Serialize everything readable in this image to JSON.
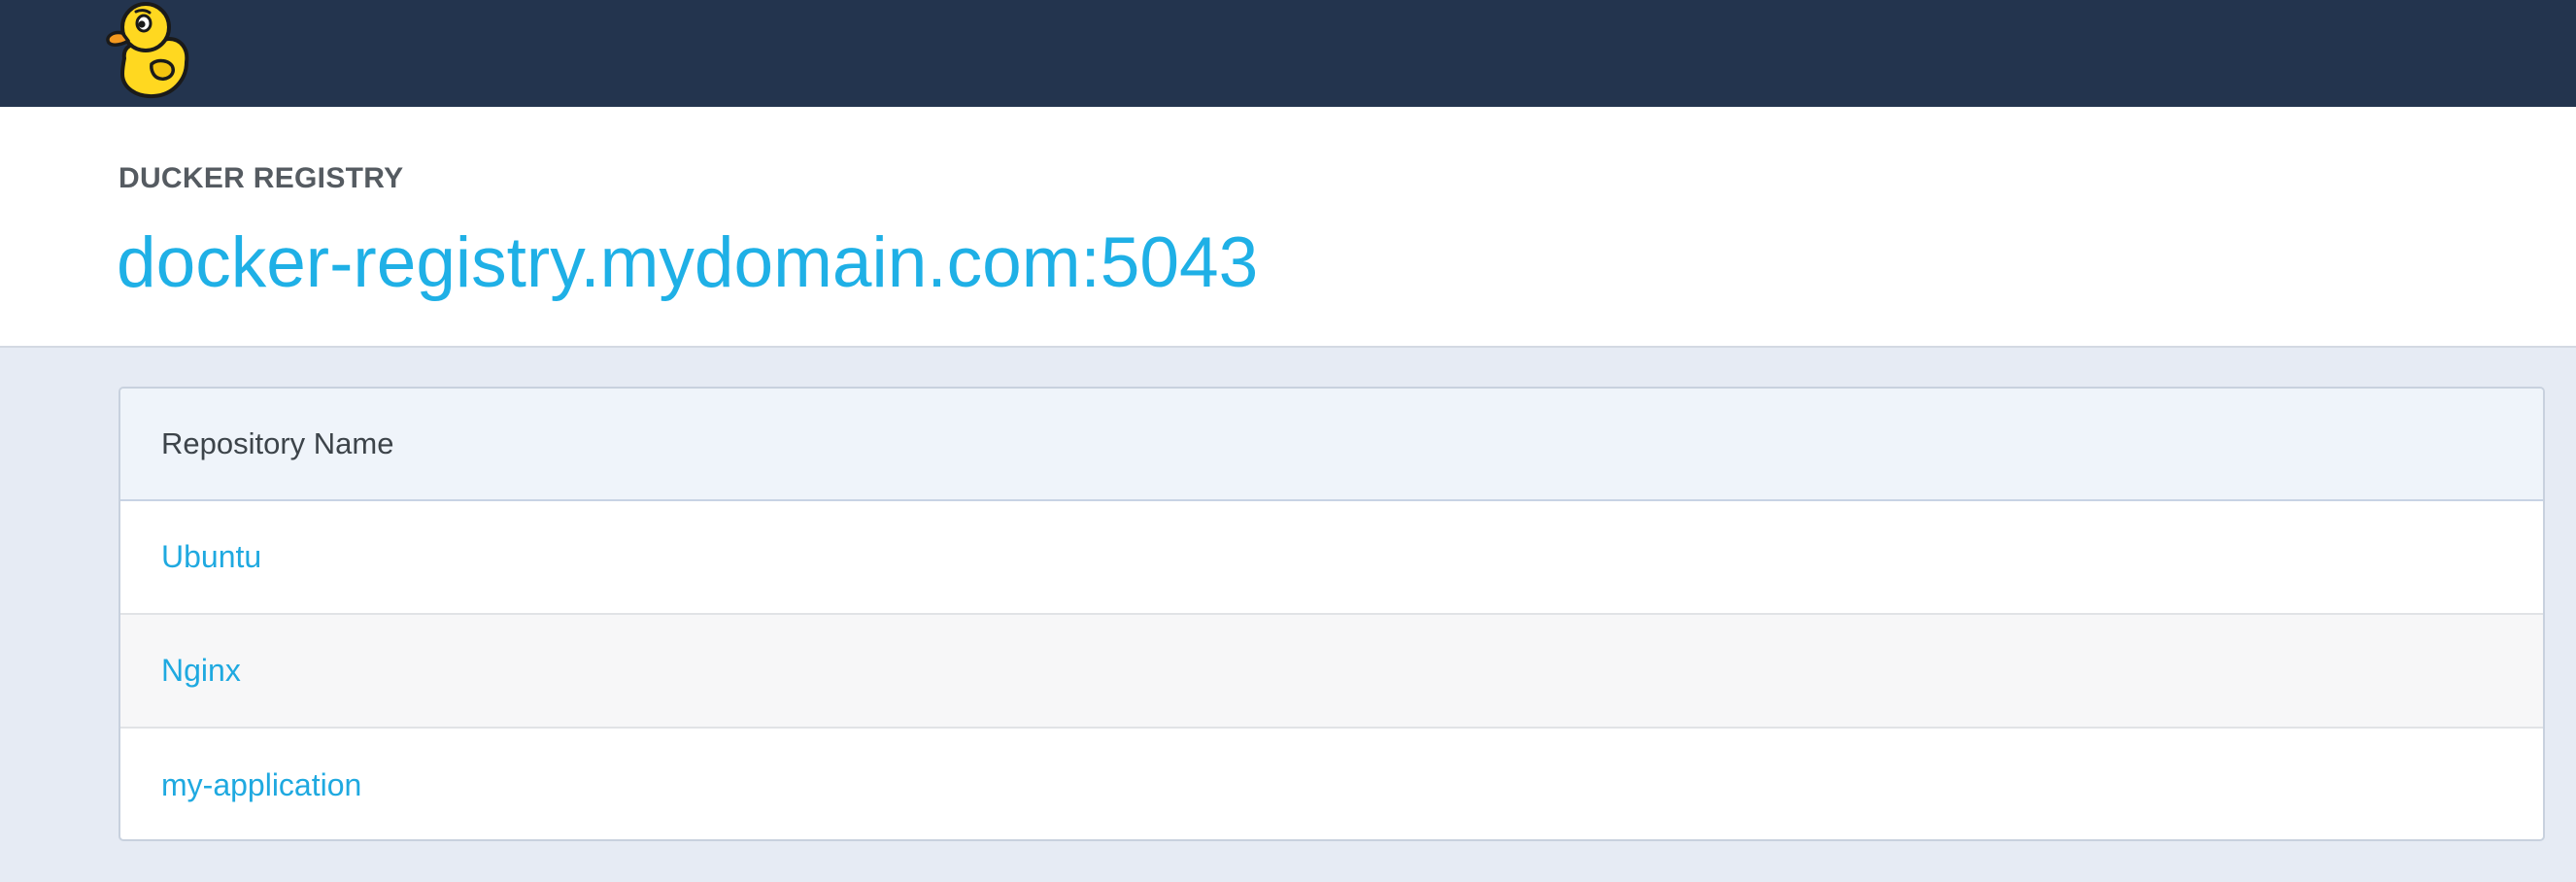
{
  "app": {
    "subtitle": "DUCKER REGISTRY",
    "title": "docker-registry.mydomain.com:5043",
    "logo_icon": "rubber-duck-icon"
  },
  "table": {
    "header": "Repository Name",
    "rows": [
      {
        "name": "Ubuntu"
      },
      {
        "name": "Nginx"
      },
      {
        "name": "my-application"
      }
    ]
  },
  "colors": {
    "topbar": "#23344e",
    "accent": "#1fb0e6",
    "page_background": "#e6ebf4",
    "duck_yellow": "#ffd820"
  }
}
